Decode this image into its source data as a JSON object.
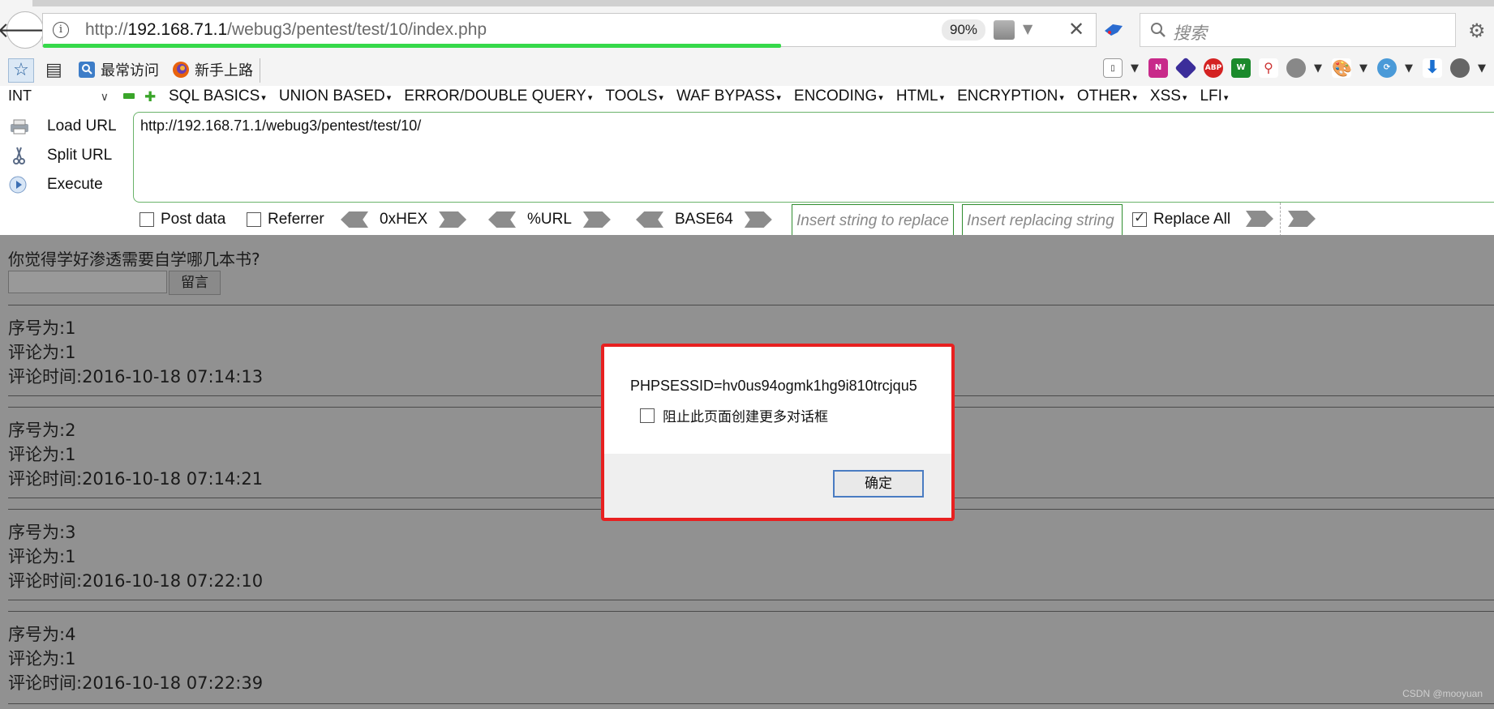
{
  "browser": {
    "url_prefix": "http://",
    "url_host": "192.168.71.1",
    "url_path": "/webug3/pentest/test/10/index.php",
    "zoom": "90%",
    "search_placeholder": "搜索",
    "load_progress": 0.7
  },
  "bookmarks": [
    {
      "label": "最常访问"
    },
    {
      "label": "新手上路"
    }
  ],
  "hackbar": {
    "type_select": "INT",
    "menus": [
      "SQL BASICS",
      "UNION BASED",
      "ERROR/DOUBLE QUERY",
      "TOOLS",
      "WAF BYPASS",
      "ENCODING",
      "HTML",
      "ENCRYPTION",
      "OTHER",
      "XSS",
      "LFI"
    ],
    "actions": [
      "Load URL",
      "Split URL",
      "Execute"
    ],
    "url_value": "http://192.168.71.1/webug3/pentest/test/10/",
    "post_data_label": "Post data",
    "referrer_label": "Referrer",
    "encoders": [
      "0xHEX",
      "%URL",
      "BASE64"
    ],
    "find_placeholder": "Insert string to replace",
    "replace_placeholder": "Insert replacing string",
    "replace_all_label": "Replace All"
  },
  "page": {
    "question": "你觉得学好渗透需要自学哪几本书?",
    "submit_label": "留言",
    "entries": [
      {
        "id_line": "序号为:1",
        "comment_line": "评论为:1",
        "time_line": "评论时间:2016-10-18 07:14:13"
      },
      {
        "id_line": "序号为:2",
        "comment_line": "评论为:1",
        "time_line": "评论时间:2016-10-18 07:14:21"
      },
      {
        "id_line": "序号为:3",
        "comment_line": "评论为:1",
        "time_line": "评论时间:2016-10-18 07:22:10"
      },
      {
        "id_line": "序号为:4",
        "comment_line": "评论为:1",
        "time_line": "评论时间:2016-10-18 07:22:39"
      }
    ],
    "watermark": "CSDN @mooyuan"
  },
  "dialog": {
    "message": "PHPSESSID=hv0us94ogmk1hg9i810trcjqu5",
    "checkbox_label": "阻止此页面创建更多对话框",
    "ok_label": "确定",
    "highlight_color": "#e82020"
  }
}
